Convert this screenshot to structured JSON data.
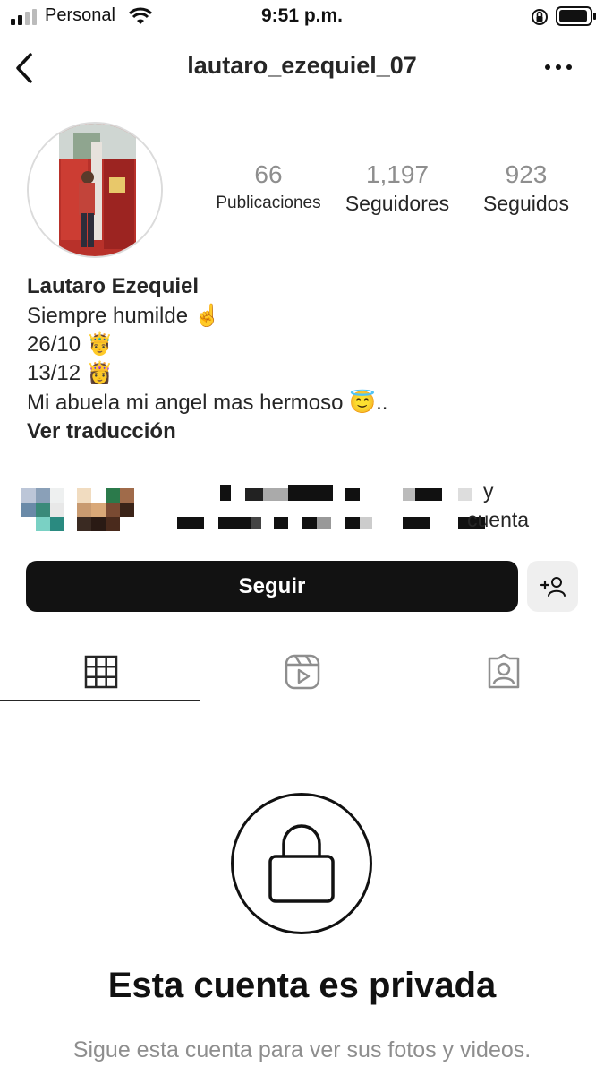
{
  "status_bar": {
    "carrier": "Personal",
    "time": "9:51 p.m."
  },
  "header": {
    "username": "lautaro_ezequiel_07"
  },
  "profile": {
    "stats": [
      {
        "value": "66",
        "label": "Publicaciones"
      },
      {
        "value": "1,197",
        "label": "Seguidores"
      },
      {
        "value": "923",
        "label": "Seguidos"
      }
    ],
    "name": "Lautaro Ezequiel",
    "bio": [
      {
        "text": "Siempre humilde",
        "emoji": "☝️"
      },
      {
        "text": "26/10",
        "emoji": "🤴"
      },
      {
        "text": "13/12",
        "emoji": "👸"
      },
      {
        "text": "Mi abuela mi angel mas hermoso",
        "emoji": "😇",
        "suffix": ".."
      }
    ],
    "see_translation": "Ver traducción",
    "followed_by_visible_1": "y",
    "followed_by_visible_2": "cuenta"
  },
  "actions": {
    "follow_label": "Seguir"
  },
  "private": {
    "title": "Esta cuenta es privada",
    "subtitle": "Sigue esta cuenta para ver sus fotos y videos."
  }
}
